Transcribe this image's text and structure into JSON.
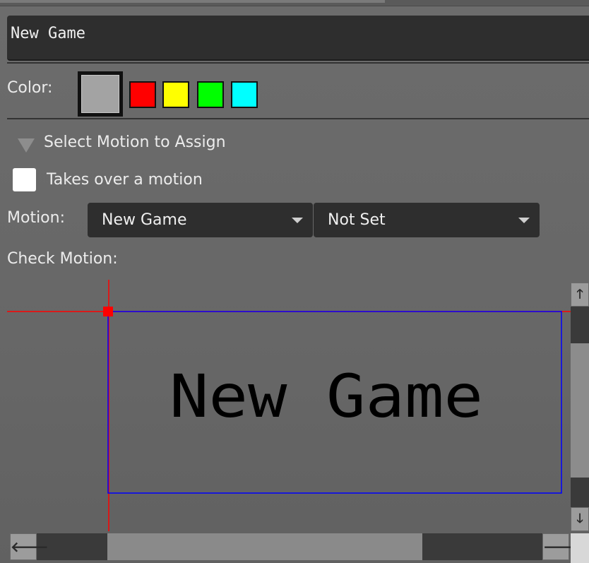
{
  "name_field": {
    "value": "New Game"
  },
  "color": {
    "label": "Color:",
    "selected": "#a3a3a3",
    "swatches": [
      "#ff0000",
      "#ffff00",
      "#00ff00",
      "#00ffff"
    ]
  },
  "motion_section": {
    "title": "Select Motion to Assign",
    "takeover_label": "Takes over a motion",
    "takeover_checked": false,
    "motion_label": "Motion:",
    "motion_value": "New Game",
    "motion_sub_value": "Not Set",
    "check_label": "Check Motion:"
  },
  "preview": {
    "text": "New Game",
    "colors": {
      "guide": "#ff0000",
      "frame": "#0000ff",
      "text": "#000000"
    }
  },
  "scrollbars": {
    "vertical": {
      "up_icon": "arrow-up-icon",
      "down_icon": "arrow-down-icon"
    },
    "horizontal": {
      "left_icon": "arrow-left-icon",
      "right_icon": "arrow-right-icon"
    }
  }
}
